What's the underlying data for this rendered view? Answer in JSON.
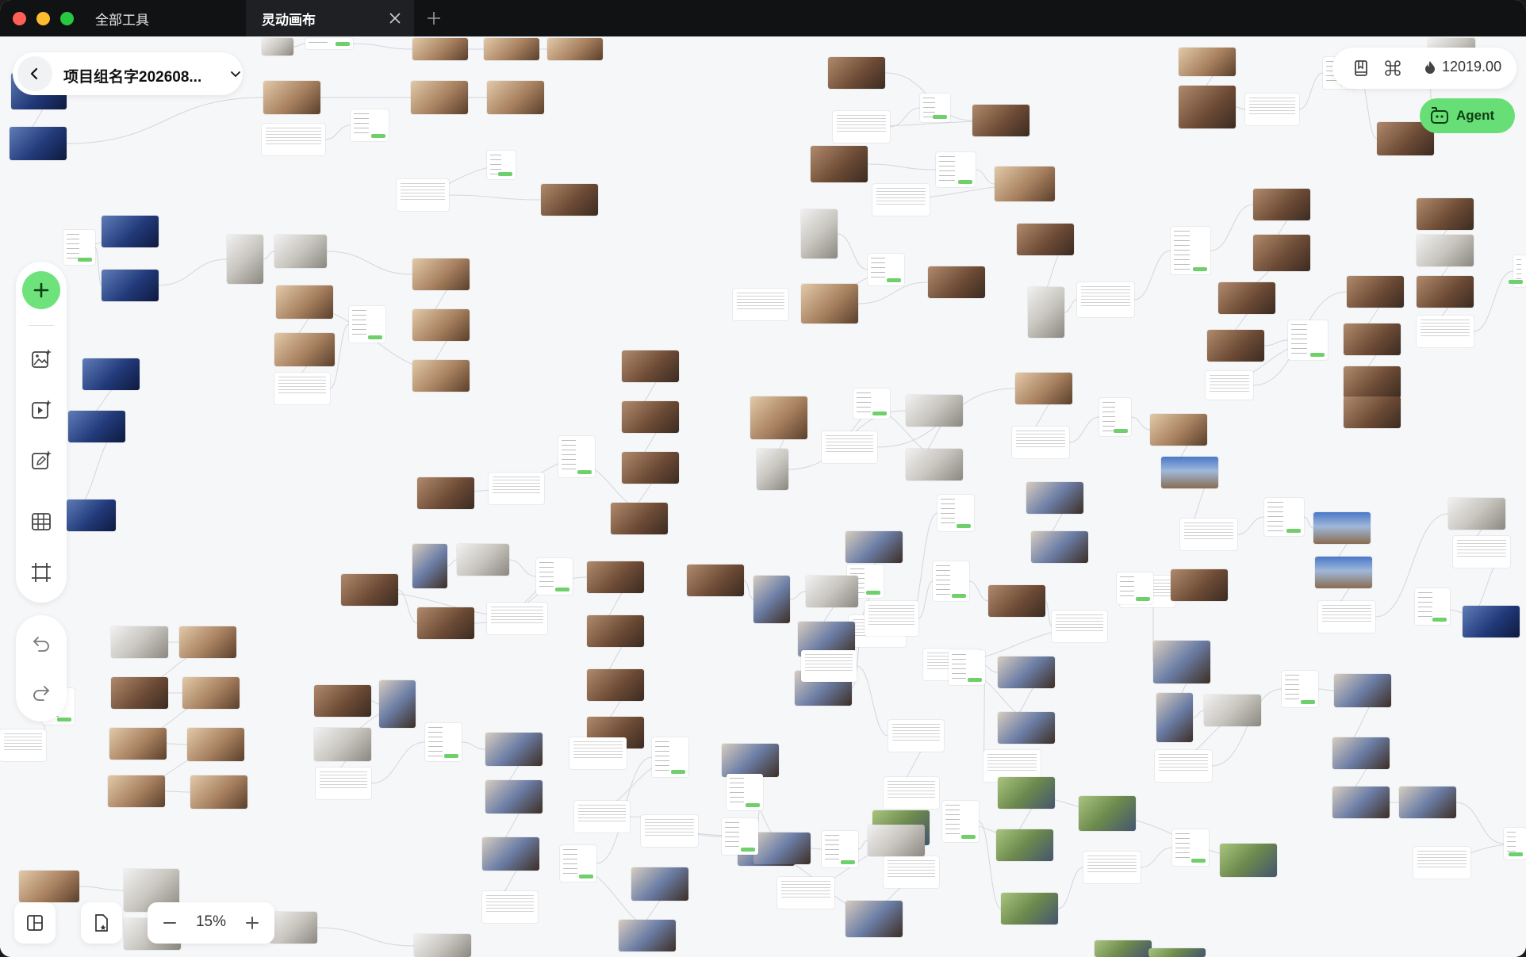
{
  "window": {
    "tabs": [
      {
        "label": "全部工具"
      },
      {
        "label": "灵动画布"
      }
    ]
  },
  "project": {
    "name": "项目组名字202608..."
  },
  "header": {
    "credits": "12019.00",
    "agent_label": "Agent"
  },
  "zoom": {
    "level": "15%"
  },
  "colors": {
    "accent": "#6ee37b",
    "titlebar": "#111214",
    "canvas": "#f6f7f9"
  }
}
